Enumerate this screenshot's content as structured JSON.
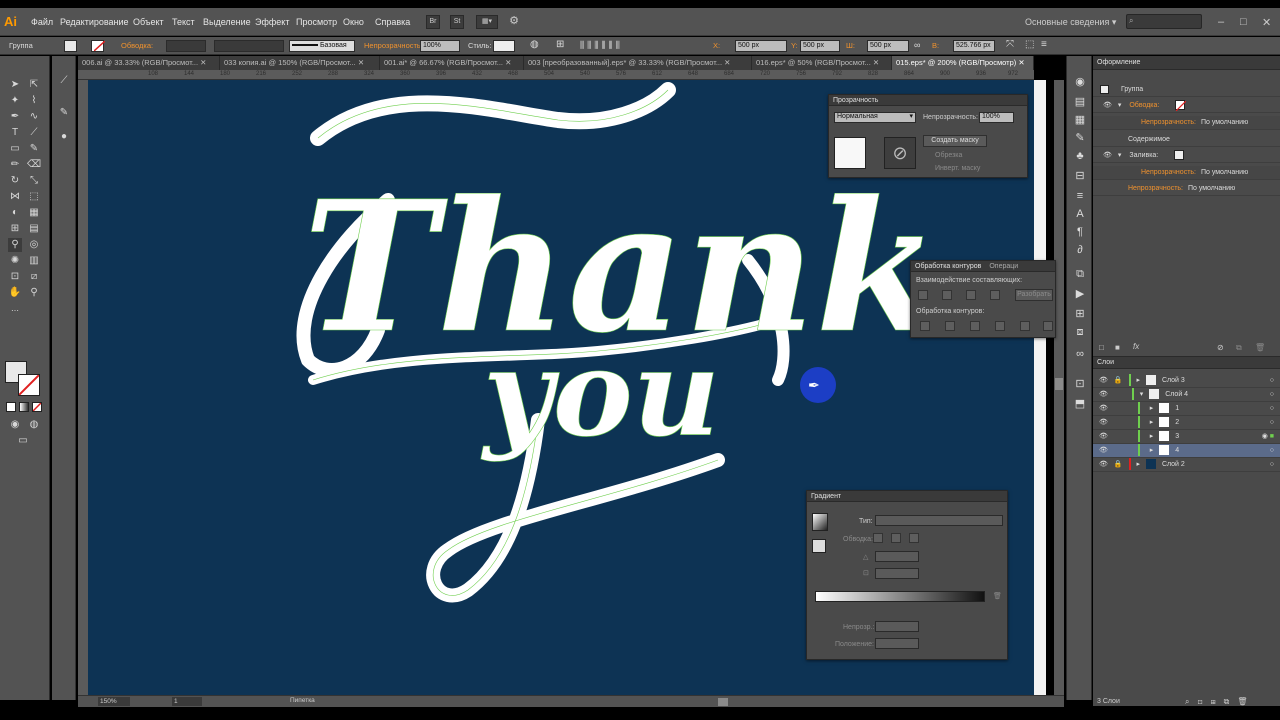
{
  "menu": {
    "items": [
      "Файл",
      "Редактирование",
      "Объект",
      "Текст",
      "Выделение",
      "Эффект",
      "Просмотр",
      "Окно",
      "Справка"
    ],
    "btn_br": "Br",
    "btn_st": "St",
    "workspace": "Основные сведения",
    "search_placeholder": ""
  },
  "control": {
    "group": "Группа",
    "stroke_label": "Обводка:",
    "stroke_style": "Базовая",
    "opacity_label": "Непрозрачность:",
    "opacity_value": "100%",
    "style_label": "Стиль:",
    "x_label": "X:",
    "x_value": "500 px",
    "y_label": "Y:",
    "y_value": "500 px",
    "w_label": "Ш:",
    "w_value": "500 px",
    "h_label": "В:",
    "h_value": "525.766 px"
  },
  "tabs": [
    "006.ai @ 33.33% (RGB/Просмот...",
    "033 копия.ai @ 150% (RGB/Просмот...",
    "001.ai* @ 66.67% (RGB/Просмот...",
    "003 [преобразованный].eps* @ 33.33% (RGB/Просмот...",
    "016.eps* @ 50% (RGB/Просмот...",
    "015.eps* @ 200% (RGB/Просмотр)"
  ],
  "ruler_ticks": [
    "108",
    "144",
    "180",
    "216",
    "252",
    "288",
    "324",
    "360",
    "396",
    "432",
    "468",
    "504",
    "540",
    "576",
    "612",
    "648",
    "684",
    "720",
    "756",
    "792",
    "828",
    "864",
    "900",
    "936",
    "972"
  ],
  "artwork": {
    "line1": "Thank",
    "line2": "you"
  },
  "transparency_panel": {
    "title": "Прозрачность",
    "blend_mode": "Нормальная",
    "opacity_label": "Непрозрачность:",
    "opacity_value": "100%",
    "make_mask": "Создать маску",
    "clip": "Обрезка",
    "invert_mask": "Инверт. маску"
  },
  "pathfinder_panel": {
    "tab1": "Обработка контуров",
    "tab2": "Операци",
    "shape_modes": "Взаимодействие составляющих:",
    "expand": "Разобрать",
    "pathfinders": "Обработка контуров:"
  },
  "gradient_panel": {
    "title": "Градиент",
    "type_label": "Тип:",
    "stroke_label": "Обводка:",
    "opacity_label": "Непрозр.:",
    "position_label": "Положение:"
  },
  "appearance_panel": {
    "title": "Оформление",
    "group": "Группа",
    "stroke": "Обводка:",
    "opacity": "Непрозрачность:",
    "default": "По умолчанию",
    "contents": "Содержимое",
    "fill": "Заливка:"
  },
  "layers_panel": {
    "title": "Слои",
    "rows": [
      {
        "name": "Слой 3",
        "indent": 0
      },
      {
        "name": "Слой 4",
        "indent": 0
      },
      {
        "name": "1",
        "indent": 1
      },
      {
        "name": "2",
        "indent": 1
      },
      {
        "name": "3",
        "indent": 1
      },
      {
        "name": "4",
        "indent": 1
      },
      {
        "name": "Слой 2",
        "indent": 0
      }
    ],
    "count": "3 Слои"
  },
  "status": {
    "zoom": "150%",
    "artboard": "1",
    "tool": "Пипетка"
  },
  "colors": {
    "canvas": "#0d3354",
    "ui_bg": "#535353",
    "accent_orange": "#f0922e",
    "path_green": "#6fcf4e",
    "cursor_blue": "#1d3fcf"
  }
}
